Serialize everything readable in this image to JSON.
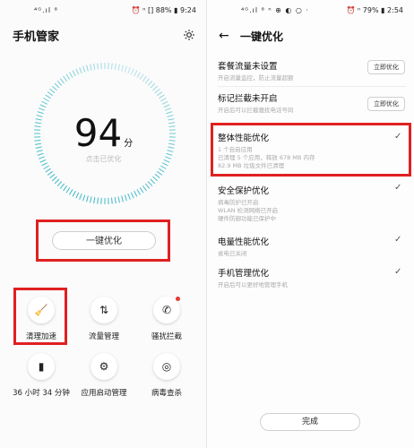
{
  "left": {
    "status": {
      "left_icons": "⁴ᴳ.ıl ⁸",
      "right": "⏰ ⁿ [] 88% ▮ 9:24"
    },
    "title": "手机管家",
    "score": {
      "value": "94",
      "unit": "分",
      "subtitle": "点击已优化"
    },
    "optimize_button": "一键优化",
    "tools": [
      {
        "label": "清理加速",
        "icon": "🧹"
      },
      {
        "label": "流量管理",
        "icon": "⇅"
      },
      {
        "label": "骚扰拦截",
        "icon": "✆"
      },
      {
        "label": "36 小时 34 分钟",
        "icon": "▮"
      },
      {
        "label": "应用启动管理",
        "icon": "⚙"
      },
      {
        "label": "病毒查杀",
        "icon": "◎"
      }
    ]
  },
  "right": {
    "status": {
      "left_icons": "⁴ᴳ.ıl ⁸ ⁿ ⊕ ◐ ○ ·",
      "right": "⏰ ⁿ 79% ▮ 2:54"
    },
    "title": "一键优化",
    "items": [
      {
        "title": "套餐流量未设置",
        "sub": "开启流量监控，防止流量超额",
        "action": "立即优化"
      },
      {
        "title": "标记拦截未开启",
        "sub": "开启后可以拦截骚扰电话号码",
        "action": "立即优化"
      },
      {
        "title": "整体性能优化",
        "sub": "1 个自启应用\n已清理 5 个应用，释放 678 MB 内存\n82.9 MB 垃圾文件已清理",
        "check": "✓"
      },
      {
        "title": "安全保护优化",
        "sub": "病毒防护已开启\nWLAN 检测网络已开启\n硬件防御功能已保护中",
        "check": "✓"
      },
      {
        "title": "电量性能优化",
        "sub": "省电已关闭",
        "check": "✓"
      },
      {
        "title": "手机管理优化",
        "sub": "开启后可以更好地管理手机",
        "check": "✓"
      }
    ],
    "done_button": "完成"
  },
  "colors": {
    "highlight": "#e02020",
    "accent_ring": "#3ab7c8"
  }
}
